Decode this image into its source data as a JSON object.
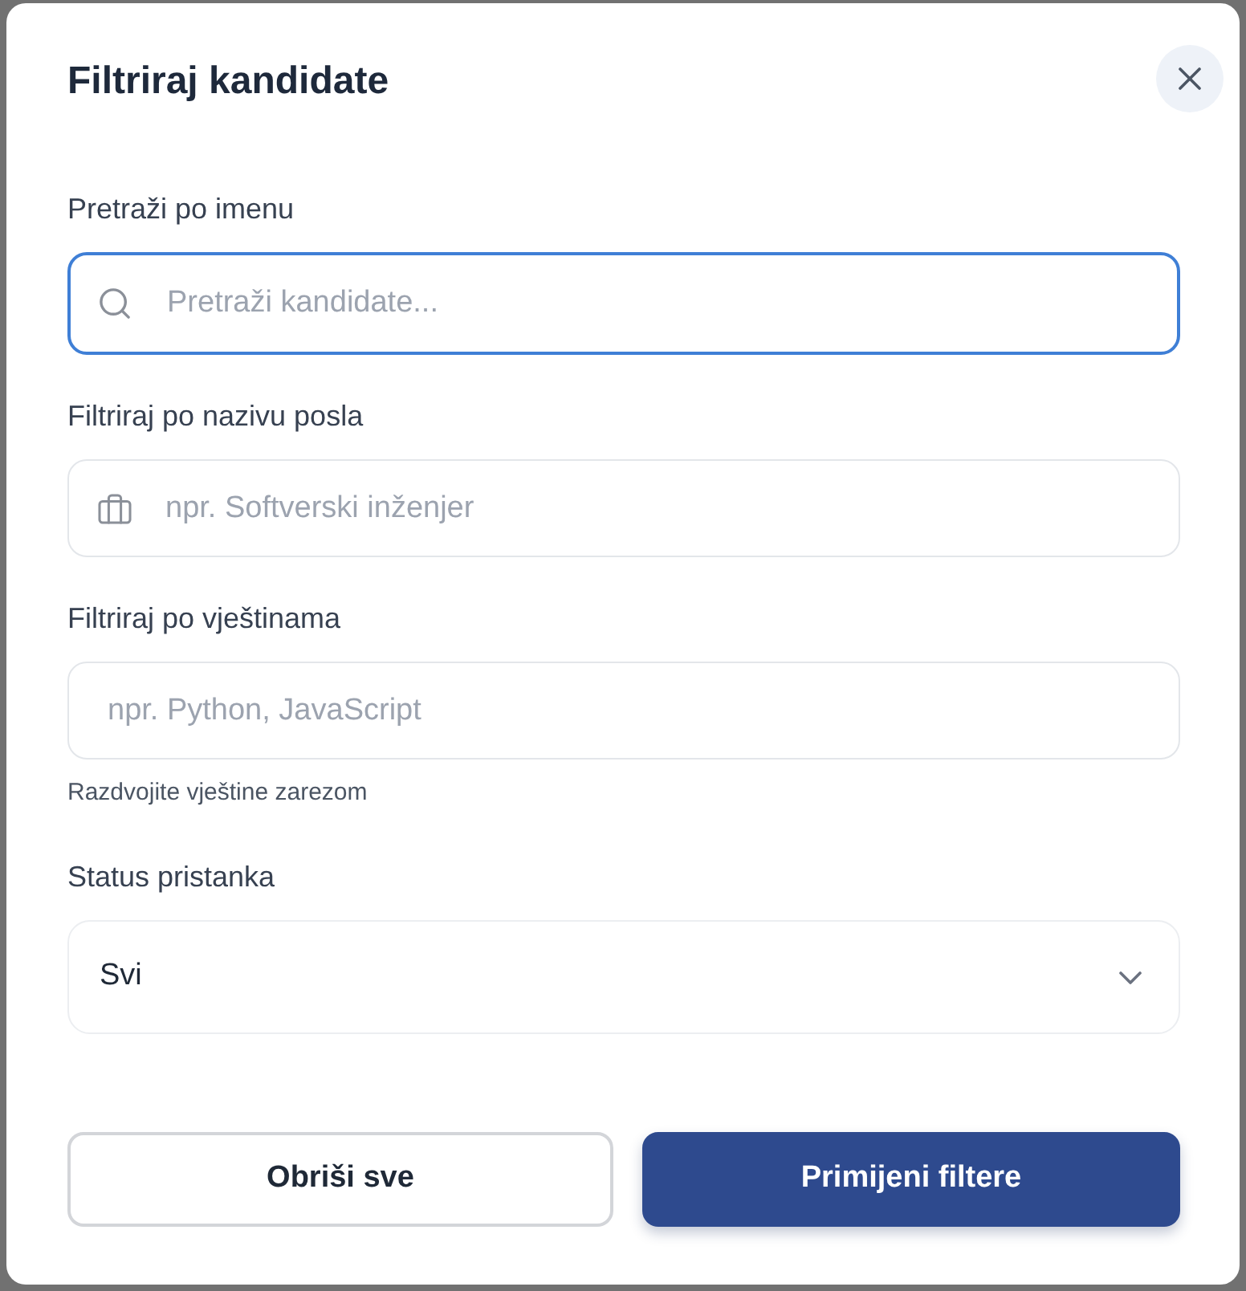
{
  "dialog": {
    "title": "Filtriraj kandidate"
  },
  "fields": [
    {
      "kind": "search",
      "label": "Pretraži po imenu",
      "placeholder": "Pretraži kandidate...",
      "focused": true
    },
    {
      "kind": "job",
      "label": "Filtriraj po nazivu posla",
      "placeholder": "npr. Softverski inženjer",
      "focused": false
    },
    {
      "kind": "text",
      "label": "Filtriraj po vještinama",
      "placeholder": "npr. Python, JavaScript",
      "focused": false,
      "hint": "Razdvojite vještine zarezom"
    }
  ],
  "status_select": {
    "label": "Status pristanka",
    "value": "Svi"
  },
  "buttons": [
    {
      "kind": "secondary",
      "label": "Obriši sve"
    },
    {
      "kind": "primary",
      "label": "Primijeni filtere"
    }
  ]
}
